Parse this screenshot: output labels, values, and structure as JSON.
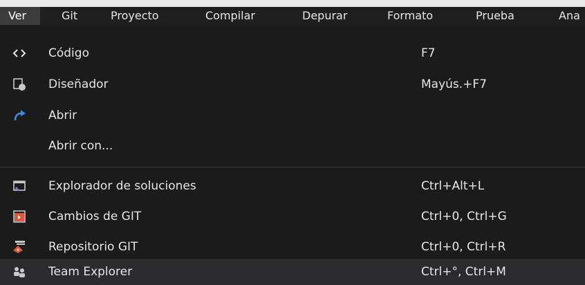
{
  "menubar": {
    "items": [
      {
        "label": "Ver"
      },
      {
        "label": "Git"
      },
      {
        "label": "Proyecto"
      },
      {
        "label": "Compilar"
      },
      {
        "label": "Depurar"
      },
      {
        "label": "Formato"
      },
      {
        "label": "Prueba"
      },
      {
        "label": "Ana"
      }
    ]
  },
  "dropdown": {
    "items": [
      {
        "label": "Código",
        "shortcut": "F7",
        "icon": "code-icon"
      },
      {
        "label": "Diseñador",
        "shortcut": "Mayús.+F7",
        "icon": "designer-icon"
      },
      {
        "label": "Abrir",
        "shortcut": "",
        "icon": "open-icon"
      },
      {
        "label": "Abrir con...",
        "shortcut": "",
        "icon": ""
      },
      {
        "label": "Explorador de soluciones",
        "shortcut": "Ctrl+Alt+L",
        "icon": "solution-explorer-icon"
      },
      {
        "label": "Cambios de GIT",
        "shortcut": "Ctrl+0, Ctrl+G",
        "icon": "git-changes-icon"
      },
      {
        "label": "Repositorio GIT",
        "shortcut": "Ctrl+0, Ctrl+R",
        "icon": "git-repository-icon"
      },
      {
        "label": "Team Explorer",
        "shortcut": "Ctrl+°, Ctrl+M",
        "icon": "team-explorer-icon"
      }
    ]
  },
  "colors": {
    "background": "#1f1f1f",
    "text": "#e6e6e6",
    "hover": "#2b2b2d",
    "active_menu": "#3c3c3c",
    "accent_blue": "#3c8de6",
    "accent_purple": "#8f6bd6",
    "git_red": "#e2543c"
  }
}
